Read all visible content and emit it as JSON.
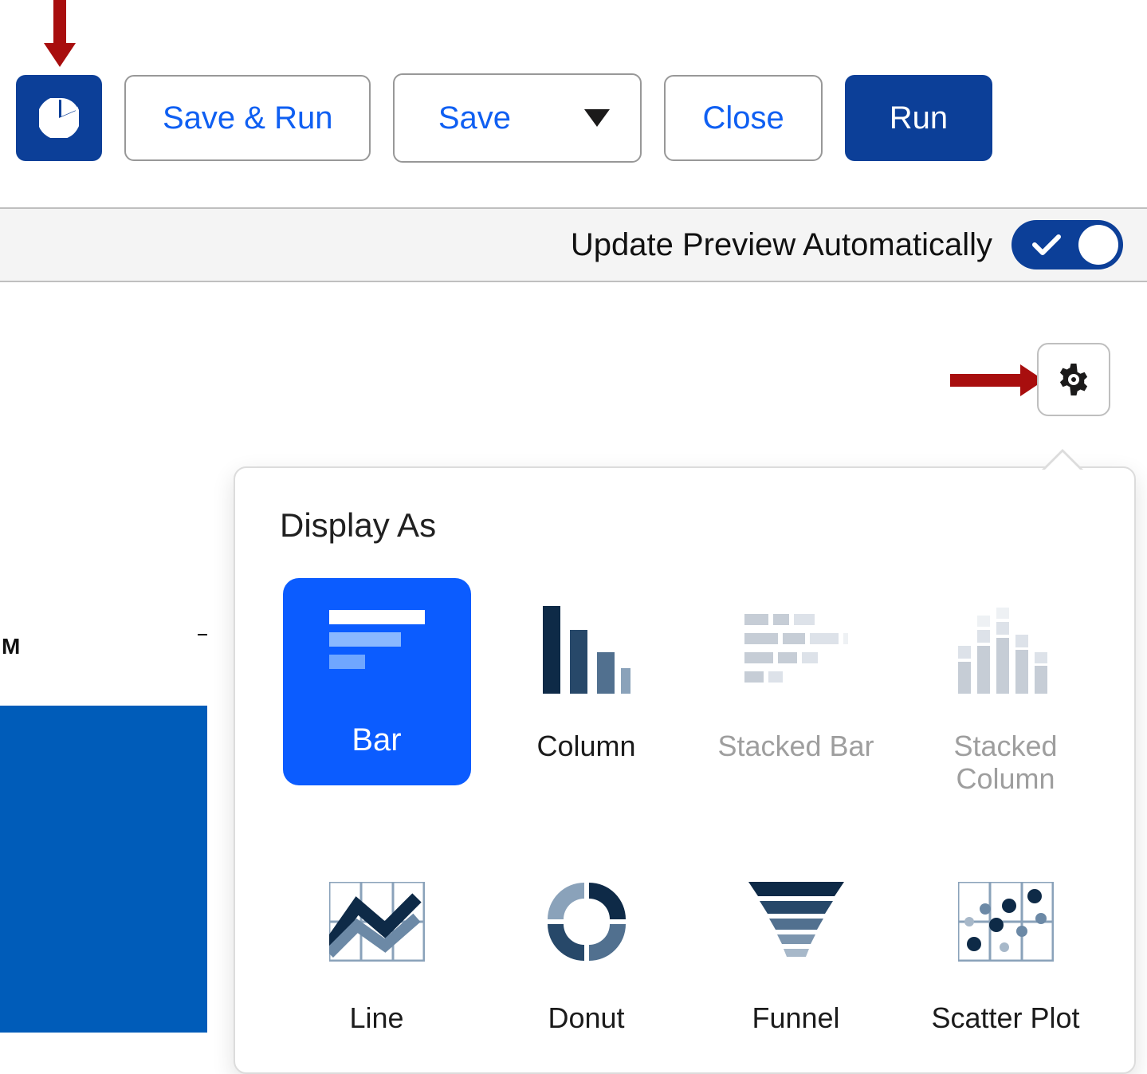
{
  "toolbar": {
    "save_and_run_label": "Save & Run",
    "save_label": "Save",
    "close_label": "Close",
    "run_label": "Run"
  },
  "preview": {
    "auto_label": "Update Preview Automatically",
    "auto_enabled": true,
    "y_tick_label": "M"
  },
  "popover": {
    "title": "Display As",
    "options": [
      {
        "name": "Bar",
        "selected": true,
        "disabled": false
      },
      {
        "name": "Column",
        "selected": false,
        "disabled": false
      },
      {
        "name": "Stacked Bar",
        "selected": false,
        "disabled": true
      },
      {
        "name": "Stacked Column",
        "selected": false,
        "disabled": true
      },
      {
        "name": "Line",
        "selected": false,
        "disabled": false
      },
      {
        "name": "Donut",
        "selected": false,
        "disabled": false
      },
      {
        "name": "Funnel",
        "selected": false,
        "disabled": false
      },
      {
        "name": "Scatter Plot",
        "selected": false,
        "disabled": false
      }
    ]
  },
  "colors": {
    "brand_dark": "#0c3f98",
    "brand_bright": "#0b5cff",
    "danger_arrow": "#a80e0e"
  }
}
